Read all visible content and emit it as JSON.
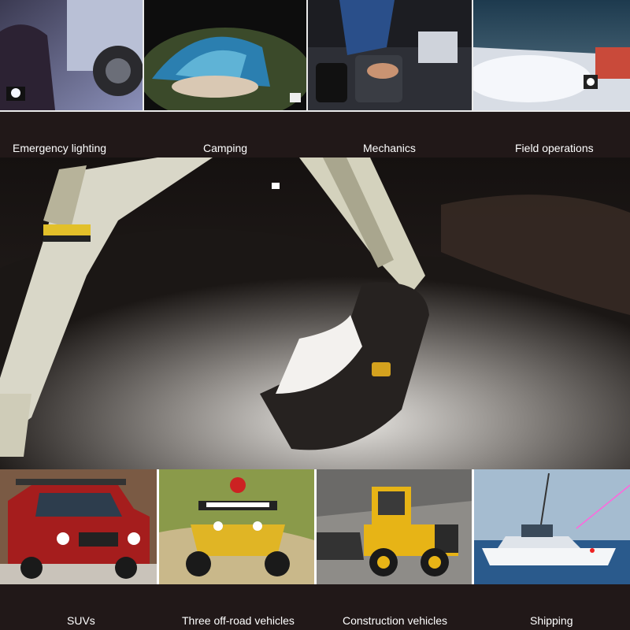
{
  "top_captions": {
    "emergency": "Emergency lighting",
    "camping": "Camping",
    "mechanics": "Mechanics",
    "field": "Field operations"
  },
  "bottom_captions": {
    "suvs": "SUVs",
    "offroad": "Three off-road vehicles",
    "construction": "Construction vehicles",
    "shipping": "Shipping"
  },
  "brand_colors": {
    "band": "#211818",
    "caption_text": "#ffffff"
  }
}
